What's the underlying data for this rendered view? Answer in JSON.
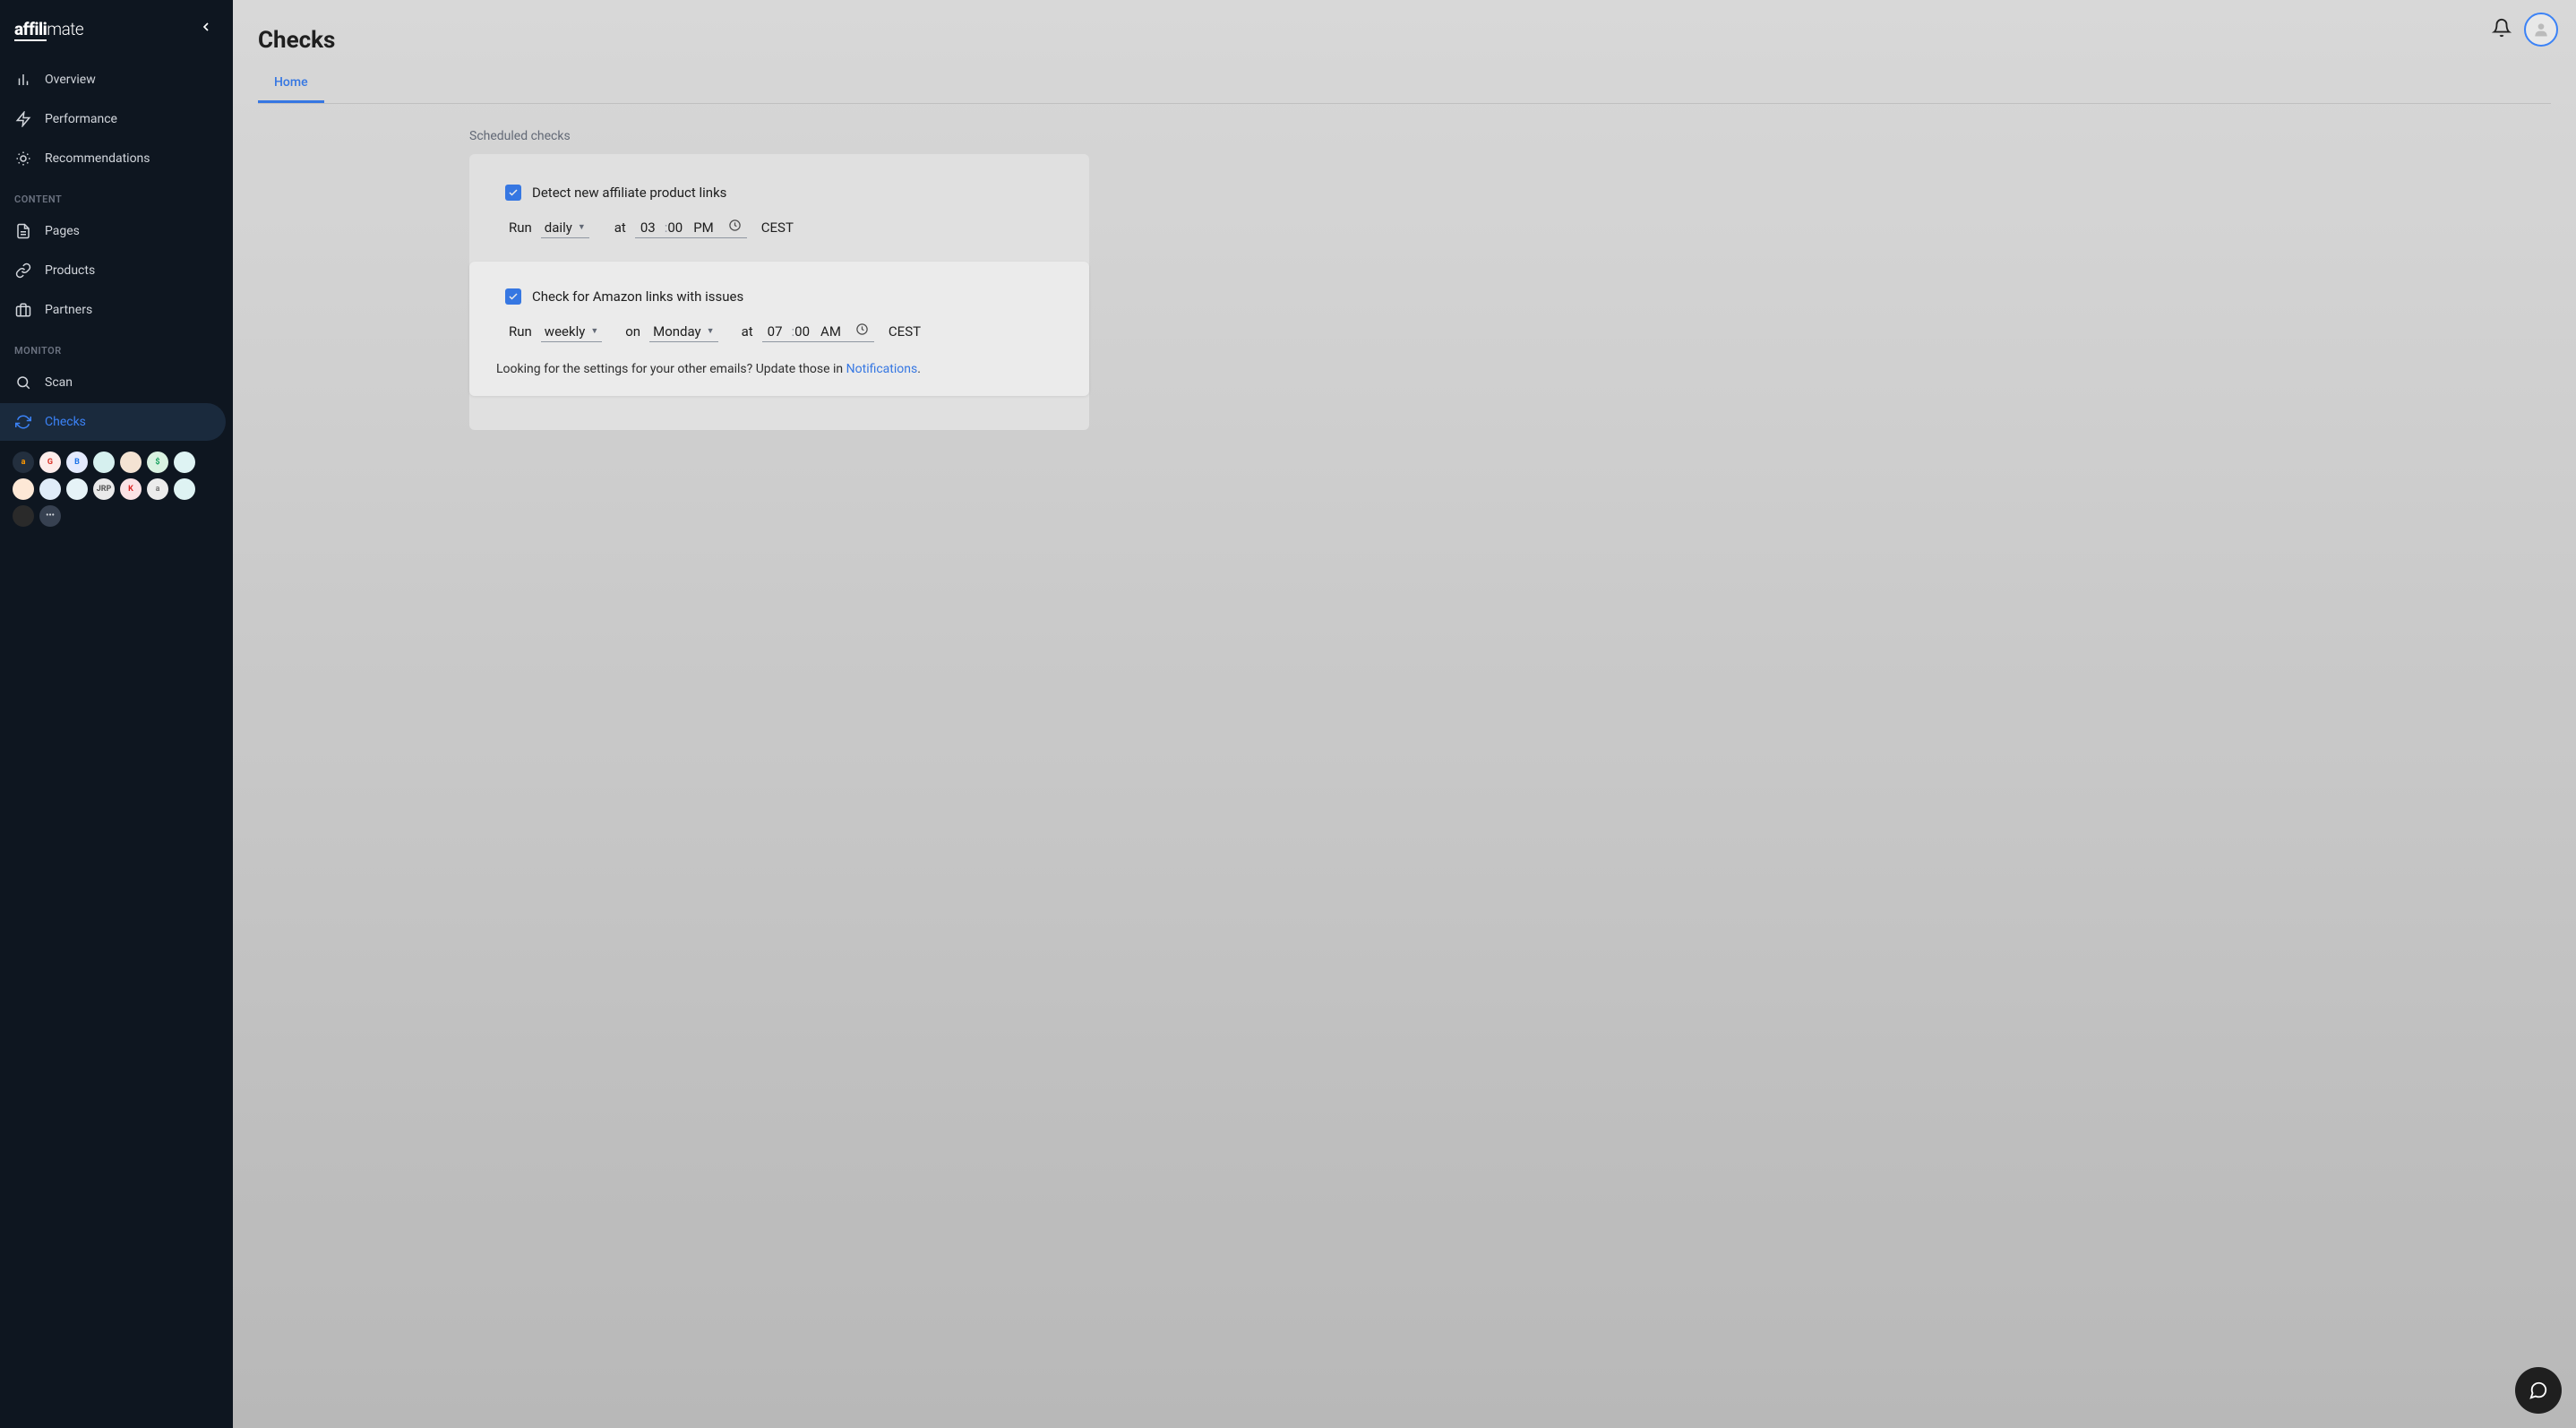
{
  "brand": {
    "strong": "affili",
    "light": "mate"
  },
  "sidebar": {
    "nav_top": [
      {
        "label": "Overview"
      },
      {
        "label": "Performance"
      },
      {
        "label": "Recommendations"
      }
    ],
    "section_content_title": "CONTENT",
    "nav_content": [
      {
        "label": "Pages"
      },
      {
        "label": "Products"
      },
      {
        "label": "Partners"
      }
    ],
    "section_monitor_title": "MONITOR",
    "nav_monitor": [
      {
        "label": "Scan"
      },
      {
        "label": "Checks"
      }
    ],
    "partner_badges": [
      {
        "bg": "#232f3e",
        "fg": "#ff9900",
        "text": "a"
      },
      {
        "bg": "#fdecea",
        "fg": "#d93025",
        "text": "G"
      },
      {
        "bg": "#e3eafd",
        "fg": "#1a73e8",
        "text": "B"
      },
      {
        "bg": "#d6f0ef",
        "fg": "#0b8f8f",
        "text": ""
      },
      {
        "bg": "#f4e3d3",
        "fg": "#c2410c",
        "text": ""
      },
      {
        "bg": "#d9f2e1",
        "fg": "#0f9d58",
        "text": "$"
      },
      {
        "bg": "#def3f3",
        "fg": "#0ea5a5",
        "text": ""
      },
      {
        "bg": "#fde8d6",
        "fg": "#ea580c",
        "text": ""
      },
      {
        "bg": "#e0ecf8",
        "fg": "#2563eb",
        "text": ""
      },
      {
        "bg": "#e6f3f7",
        "fg": "#0ea5e9",
        "text": ""
      },
      {
        "bg": "#eaeaea",
        "fg": "#555",
        "text": "JRP"
      },
      {
        "bg": "#fbe2e5",
        "fg": "#dc2626",
        "text": "K"
      },
      {
        "bg": "#ececec",
        "fg": "#777",
        "text": "a"
      },
      {
        "bg": "#def3f3",
        "fg": "#0ea5a5",
        "text": ""
      },
      {
        "bg": "#2a2a2a",
        "fg": "#bbb",
        "text": ""
      }
    ],
    "more_label": "•••"
  },
  "page": {
    "title": "Checks",
    "tabs": [
      {
        "label": "Home"
      }
    ],
    "section_title": "Scheduled checks",
    "checks": [
      {
        "label": "Detect new affiliate product links",
        "run_label": "Run",
        "frequency": "daily",
        "at_label": "at",
        "hour": "03",
        "minute": "00",
        "ampm": "PM",
        "tz": "CEST"
      },
      {
        "label": "Check for Amazon links with issues",
        "run_label": "Run",
        "frequency": "weekly",
        "on_label": "on",
        "day": "Monday",
        "at_label": "at",
        "hour": "07",
        "minute": "00",
        "ampm": "AM",
        "tz": "CEST"
      }
    ],
    "footer": {
      "text_before": "Looking for the settings for your other emails? Update those in ",
      "link_text": "Notifications",
      "text_after": "."
    }
  }
}
